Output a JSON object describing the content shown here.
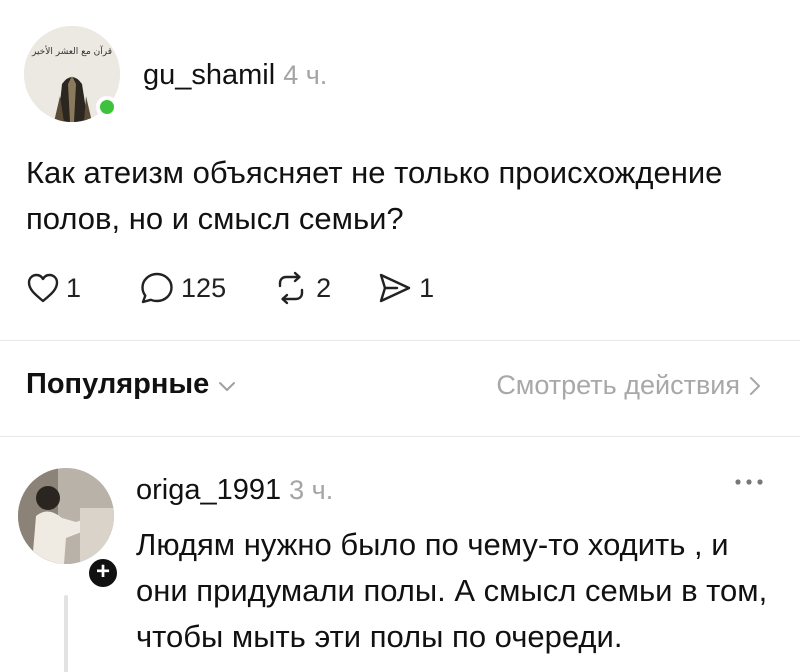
{
  "post": {
    "username": "gu_shamil",
    "time": "4 ч.",
    "avatar_caption": "قرآن مع العشر الأخير",
    "text": "Как атеизм объясняет не только происхождение полов, но и смысл семьи?",
    "actions": {
      "likes": "1",
      "comments": "125",
      "reposts": "2",
      "shares": "1"
    },
    "status_color": "#3ec23e"
  },
  "sort": {
    "label": "Популярные",
    "activity_label": "Смотреть действия"
  },
  "reply": {
    "username": "origa_1991",
    "time": "3 ч.",
    "text": "Людям нужно было по чему-то ходить , и они придумали полы. А смысл семьи в том, чтобы мыть эти полы по очереди.",
    "follow_symbol": "+"
  },
  "icons": {
    "like": "heart-icon",
    "comment": "comment-bubble-icon",
    "repost": "repost-icon",
    "share": "send-icon",
    "more": "more-dots-icon",
    "sort_chevron": "chevron-down-icon",
    "activity_chevron": "chevron-right-icon"
  }
}
